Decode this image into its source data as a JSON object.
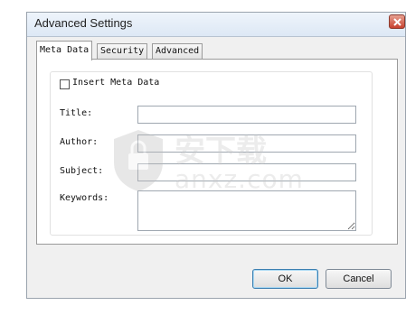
{
  "window": {
    "title": "Advanced Settings"
  },
  "tabs": [
    {
      "label": "Meta Data",
      "active": true
    },
    {
      "label": "Security",
      "active": false
    },
    {
      "label": "Advanced",
      "active": false
    }
  ],
  "meta": {
    "insert_checkbox_label": "Insert Meta Data",
    "insert_checked": false,
    "fields": {
      "title_label": "Title:",
      "author_label": "Author:",
      "subject_label": "Subject:",
      "keywords_label": "Keywords:",
      "title_value": "",
      "author_value": "",
      "subject_value": "",
      "keywords_value": ""
    }
  },
  "buttons": {
    "ok": "OK",
    "cancel": "Cancel"
  },
  "watermark": {
    "cn": "安下载",
    "text": "anxz.com"
  },
  "colors": {
    "close": "#c7412e",
    "ok_border": "#3c7fb1"
  }
}
